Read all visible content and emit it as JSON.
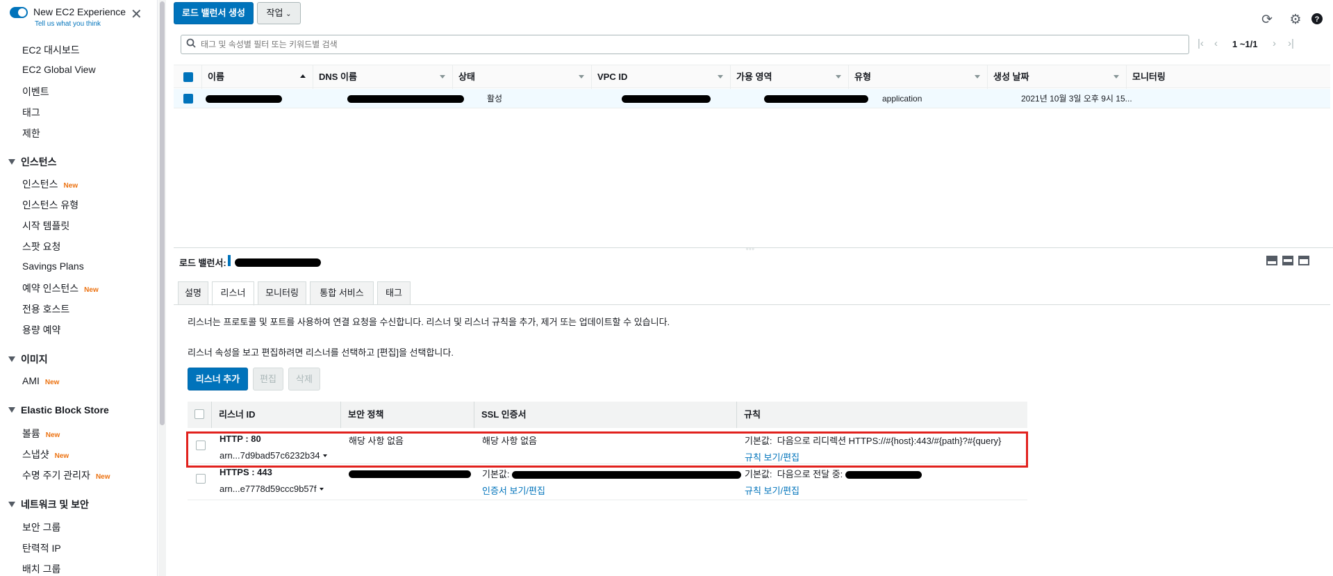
{
  "experience": {
    "title": "New EC2 Experience",
    "subtitle": "Tell us what you think"
  },
  "nav": {
    "top_items": [
      "EC2 대시보드",
      "EC2 Global View",
      "이벤트",
      "태그",
      "제한"
    ],
    "instances": {
      "heading": "인스턴스",
      "items": [
        {
          "label": "인스턴스",
          "new": "New"
        },
        {
          "label": "인스턴스 유형",
          "new": ""
        },
        {
          "label": "시작 템플릿",
          "new": ""
        },
        {
          "label": "스팟 요청",
          "new": ""
        },
        {
          "label": "Savings Plans",
          "new": ""
        },
        {
          "label": "예약 인스턴스",
          "new": "New"
        },
        {
          "label": "전용 호스트",
          "new": ""
        },
        {
          "label": "용량 예약",
          "new": ""
        }
      ]
    },
    "images": {
      "heading": "이미지",
      "items": [
        {
          "label": "AMI",
          "new": "New"
        }
      ]
    },
    "ebs": {
      "heading": "Elastic Block Store",
      "items": [
        {
          "label": "볼륨",
          "new": "New"
        },
        {
          "label": "스냅샷",
          "new": "New"
        },
        {
          "label": "수명 주기 관리자",
          "new": "New"
        }
      ]
    },
    "network": {
      "heading": "네트워크 및 보안",
      "items": [
        {
          "label": "보안 그룹",
          "new": ""
        },
        {
          "label": "탄력적 IP",
          "new": ""
        },
        {
          "label": "배치 그룹",
          "new": ""
        }
      ]
    }
  },
  "toolbar": {
    "create_label": "로드 밸런서 생성",
    "actions_label": "작업"
  },
  "search": {
    "placeholder": "태그 및 속성별 필터 또는 키워드별 검색"
  },
  "pager": {
    "text": "1 ~1/1"
  },
  "table": {
    "headers": [
      "이름",
      "DNS 이름",
      "상태",
      "VPC ID",
      "가용 영역",
      "유형",
      "생성 날짜",
      "모니터링"
    ],
    "row": {
      "state": "활성",
      "type": "application",
      "created": "2021년 10월 3일 오후 9시 15..."
    }
  },
  "detail": {
    "label": "로드 밸런서:",
    "tabs": [
      "설명",
      "리스너",
      "모니터링",
      "통합 서비스",
      "태그"
    ],
    "active_tab": "리스너",
    "para1": "리스너는 프로토콜 및 포트를 사용하여 연결 요청을 수신합니다. 리스너 및 리스너 규칙을 추가, 제거 또는 업데이트할 수 있습니다.",
    "para2": "리스너 속성을 보고 편집하려면 리스너를 선택하고 [편집]을 선택합니다.",
    "buttons": {
      "add": "리스너 추가",
      "edit": "편집",
      "delete": "삭제"
    },
    "listener_headers": [
      "리스너 ID",
      "보안 정책",
      "SSL 인증서",
      "규칙"
    ],
    "listeners": [
      {
        "id": "HTTP : 80",
        "arn": "arn...7d9bad57c6232b34",
        "policy": "해당 사항 없음",
        "cert": "해당 사항 없음",
        "rule_prefix": "기본값:",
        "rule_text": "다음으로 리디렉션 HTTPS://#{host}:443/#{path}?#{query}",
        "rule_link": "규칙 보기/편집"
      },
      {
        "id": "HTTPS : 443",
        "arn": "arn...e7778d59ccc9b57f",
        "cert_prefix": "기본값:",
        "cert_link": "인증서 보기/편집",
        "rule_prefix": "기본값:",
        "rule_text": "다음으로 전달 중:",
        "rule_link": "규칙 보기/편집"
      }
    ]
  }
}
